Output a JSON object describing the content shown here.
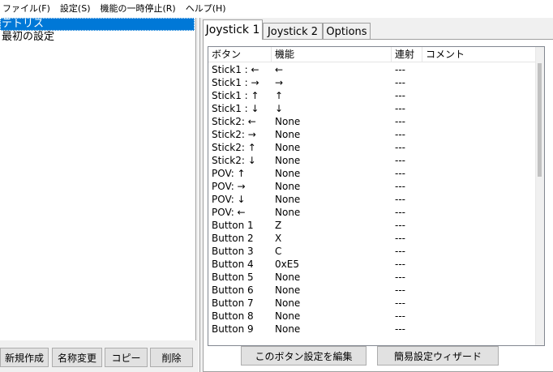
{
  "menu": [
    {
      "label": "ファイル(F)"
    },
    {
      "label": "設定(S)"
    },
    {
      "label": "機能の一時停止(R)"
    },
    {
      "label": "ヘルプ(H)"
    }
  ],
  "profiles": [
    {
      "label": "テトリス",
      "selected": true
    },
    {
      "label": "最初の設定",
      "selected": false
    }
  ],
  "left_buttons": {
    "new": "新規作成",
    "rename": "名称変更",
    "copy": "コピー",
    "delete": "削除"
  },
  "tabs": [
    {
      "label": "Joystick 1",
      "active": true
    },
    {
      "label": "Joystick 2",
      "active": false
    },
    {
      "label": "Options",
      "active": false
    }
  ],
  "table": {
    "columns": [
      "ボタン",
      "機能",
      "連射",
      "コメント"
    ],
    "rows": [
      {
        "button": "Stick1 : ←",
        "func": "←",
        "repeat": "---"
      },
      {
        "button": "Stick1 : →",
        "func": "→",
        "repeat": "---"
      },
      {
        "button": "Stick1 : ↑",
        "func": "↑",
        "repeat": "---"
      },
      {
        "button": "Stick1 : ↓",
        "func": "↓",
        "repeat": "---"
      },
      {
        "button": "Stick2: ←",
        "func": "None",
        "repeat": "---"
      },
      {
        "button": "Stick2: →",
        "func": "None",
        "repeat": "---"
      },
      {
        "button": "Stick2: ↑",
        "func": "None",
        "repeat": "---"
      },
      {
        "button": "Stick2: ↓",
        "func": "None",
        "repeat": "---"
      },
      {
        "button": "POV: ↑",
        "func": "None",
        "repeat": "---"
      },
      {
        "button": "POV: →",
        "func": "None",
        "repeat": "---"
      },
      {
        "button": "POV: ↓",
        "func": "None",
        "repeat": "---"
      },
      {
        "button": "POV: ←",
        "func": "None",
        "repeat": "---"
      },
      {
        "button": "Button 1",
        "func": "Z",
        "repeat": "---"
      },
      {
        "button": "Button 2",
        "func": "X",
        "repeat": "---"
      },
      {
        "button": "Button 3",
        "func": "C",
        "repeat": "---"
      },
      {
        "button": "Button 4",
        "func": "0xE5",
        "repeat": "---"
      },
      {
        "button": "Button 5",
        "func": "None",
        "repeat": "---"
      },
      {
        "button": "Button 6",
        "func": "None",
        "repeat": "---"
      },
      {
        "button": "Button 7",
        "func": "None",
        "repeat": "---"
      },
      {
        "button": "Button 8",
        "func": "None",
        "repeat": "---"
      },
      {
        "button": "Button 9",
        "func": "None",
        "repeat": "---"
      }
    ]
  },
  "panel_buttons": {
    "edit": "このボタン設定を編集",
    "wizard": "簡易設定ウィザード"
  },
  "colors": {
    "selection": "#0078d7",
    "button_face": "#e1e1e1",
    "window_bg": "#f0f0f0"
  }
}
